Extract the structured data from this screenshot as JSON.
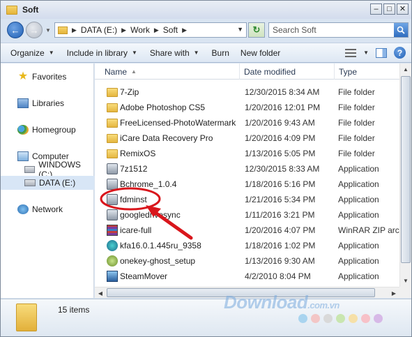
{
  "window": {
    "title": "Soft"
  },
  "address": {
    "crumbs": [
      "DATA (E:)",
      "Work",
      "Soft"
    ],
    "search_placeholder": "Search Soft"
  },
  "toolbar": {
    "organize": "Organize",
    "include": "Include in library",
    "share": "Share with",
    "burn": "Burn",
    "new_folder": "New folder"
  },
  "nav": {
    "favorites": "Favorites",
    "libraries": "Libraries",
    "homegroup": "Homegroup",
    "computer": "Computer",
    "windows_drive": "WINDOWS (C:)",
    "data_drive": "DATA (E:)",
    "network": "Network"
  },
  "columns": {
    "name": "Name",
    "date": "Date modified",
    "type": "Type"
  },
  "files": [
    {
      "name": "7-Zip",
      "date": "12/30/2015 8:34 AM",
      "type": "File folder",
      "icon": "folder-icon"
    },
    {
      "name": "Adobe Photoshop CS5",
      "date": "1/20/2016 12:01 PM",
      "type": "File folder",
      "icon": "folder-icon"
    },
    {
      "name": "FreeLicensed-PhotoWatermark",
      "date": "1/20/2016 9:43 AM",
      "type": "File folder",
      "icon": "folder-icon"
    },
    {
      "name": "iCare Data Recovery Pro",
      "date": "1/20/2016 4:09 PM",
      "type": "File folder",
      "icon": "folder-icon"
    },
    {
      "name": "RemixOS",
      "date": "1/13/2016 5:05 PM",
      "type": "File folder",
      "icon": "folder-icon"
    },
    {
      "name": "7z1512",
      "date": "12/30/2015 8:33 AM",
      "type": "Application",
      "icon": "app-icon"
    },
    {
      "name": "Bchrome_1.0.4",
      "date": "1/18/2016 5:16 PM",
      "type": "Application",
      "icon": "app-icon"
    },
    {
      "name": "fdminst",
      "date": "1/21/2016 5:34 PM",
      "type": "Application",
      "icon": "app-icon"
    },
    {
      "name": "googledrivesync",
      "date": "1/11/2016 3:21 PM",
      "type": "Application",
      "icon": "app-icon"
    },
    {
      "name": "icare-full",
      "date": "1/20/2016 4:07 PM",
      "type": "WinRAR ZIP archive",
      "icon": "rar-icon"
    },
    {
      "name": "kfa16.0.1.445ru_9358",
      "date": "1/18/2016 1:02 PM",
      "type": "Application",
      "icon": "kfa-icon"
    },
    {
      "name": "onekey-ghost_setup",
      "date": "1/13/2016 9:30 AM",
      "type": "Application",
      "icon": "ghost-icon"
    },
    {
      "name": "SteamMover",
      "date": "4/2/2010 8:04 PM",
      "type": "Application",
      "icon": "steam-icon"
    }
  ],
  "status": {
    "count": "15 items"
  },
  "watermark": {
    "text": "Download",
    "suffix": ".com.vn"
  },
  "colors": {
    "watermark_dots": [
      "#a9d4ef",
      "#f3c6c6",
      "#d9d9d9",
      "#c9e6b0",
      "#f6e0a8",
      "#f7c1c8",
      "#d7b9e7"
    ],
    "annotation": "#d9161c"
  }
}
